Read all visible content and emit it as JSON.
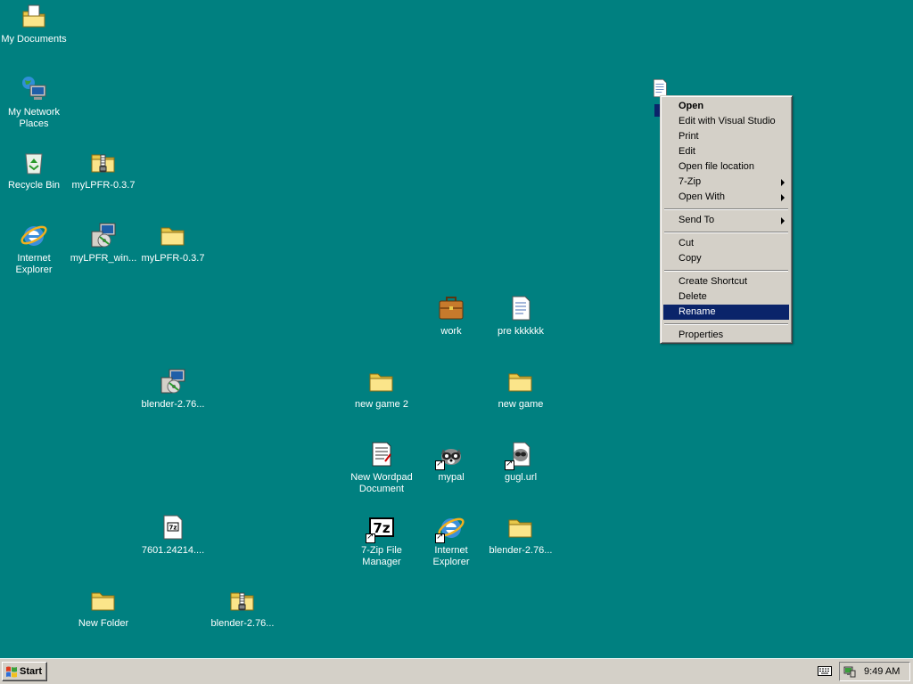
{
  "desktop": {
    "icons": {
      "my_documents": "My Documents",
      "my_network_places": "My Network Places",
      "recycle_bin": "Recycle Bin",
      "mylpfr_zip": "myLPFR-0.3.7",
      "internet_explorer": "Internet Explorer",
      "mylpfr_win": "myLPFR_win...",
      "mylpfr_folder": "myLPFR-0.3.7",
      "work": "work",
      "pre_kkkkkk": "pre kkkkkk",
      "blender_installer": "blender-2.76...",
      "new_game_2": "new game 2",
      "new_game": "new game",
      "new_wordpad": "New Wordpad Document",
      "mypal": "mypal",
      "gugl_url": "gugl.url",
      "archive_7601": "7601.24214....",
      "sevenzip_fm": "7-Zip File Manager",
      "internet_explorer_2": "Internet Explorer",
      "blender_folder": "blender-2.76...",
      "new_folder": "New Folder",
      "blender_zip": "blender-2.76..."
    }
  },
  "context_menu": {
    "open": "Open",
    "edit_vs": "Edit with Visual Studio",
    "print": "Print",
    "edit": "Edit",
    "open_location": "Open file location",
    "seven_zip": "7-Zip",
    "open_with": "Open With",
    "send_to": "Send To",
    "cut": "Cut",
    "copy": "Copy",
    "create_shortcut": "Create Shortcut",
    "delete": "Delete",
    "rename": "Rename",
    "properties": "Properties"
  },
  "taskbar": {
    "start_label": "Start",
    "clock": "9:49 AM"
  },
  "colors": {
    "desktop": "#008080",
    "face": "#d4d0c8",
    "highlight": "#0a246a"
  }
}
